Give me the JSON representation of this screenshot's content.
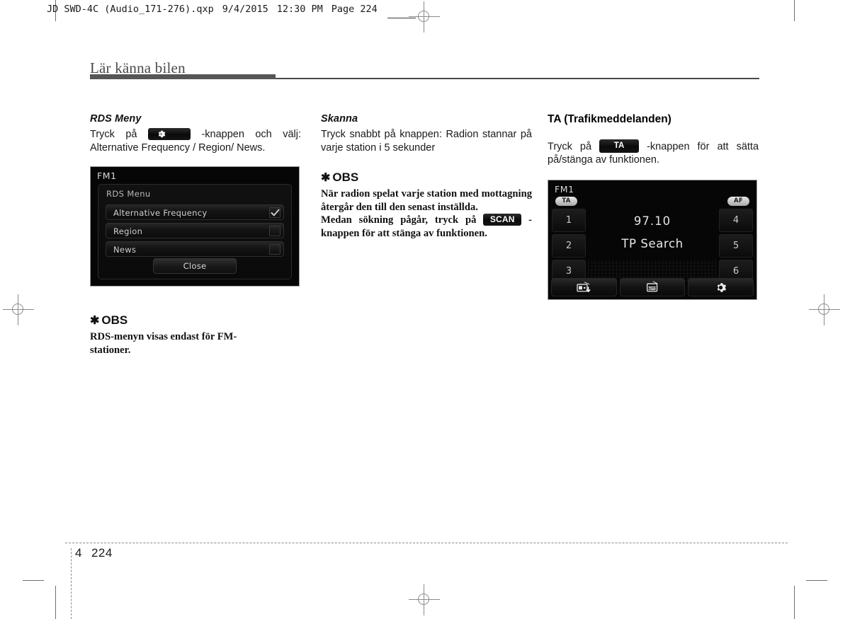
{
  "file_header": {
    "filename": "JD SWD-4C (Audio_171-276).qxp",
    "date": "9/4/2015",
    "time": "12:30 PM",
    "page_label": "Page 224"
  },
  "chapter": {
    "title": "Lär känna bilen"
  },
  "columns": {
    "col1": {
      "rds_heading": "RDS Meny",
      "rds_text_before": "Tryck på",
      "rds_button_icon": "gear-icon",
      "rds_text_after": "-knappen och välj: Alternative Frequency / Region/ News.",
      "device": {
        "label": "FM1",
        "dialog_title": "RDS Menu",
        "items": [
          {
            "label": "Alternative Frequency",
            "checked": true
          },
          {
            "label": "Region",
            "checked": false
          },
          {
            "label": "News",
            "checked": false
          }
        ],
        "close_label": "Close"
      },
      "obs": {
        "star": "✱",
        "heading": "OBS",
        "line1": "RDS-menyn visas endast för FM-",
        "line2": "stationer."
      }
    },
    "col2": {
      "scan_heading": "Skanna",
      "scan_text": "Tryck snabbt på knappen: Radion stannar på varje station i 5 sekunder",
      "obs": {
        "star": "✱",
        "heading": "OBS",
        "para1": "När radion spelat varje station med mottagning återgår den till den senast inställda.",
        "para2_before": "Medan sökning pågår, tryck på",
        "para2_button": "SCAN",
        "para2_after": "-knappen för att stänga av funktionen."
      }
    },
    "col3": {
      "ta_heading": "TA (Trafikmeddelanden)",
      "ta_text_before": "Tryck på",
      "ta_button": "TA",
      "ta_text_after": "-knappen för att sätta på/stänga av funktionen.",
      "device": {
        "label": "FM1",
        "badge_ta": "TA",
        "badge_af": "AF",
        "presets_left": [
          "1",
          "2",
          "3"
        ],
        "presets_right": [
          "4",
          "5",
          "6"
        ],
        "frequency": "97.10",
        "status": "TP Search",
        "bottom_buttons": [
          {
            "icon": "radio-save-preset-icon"
          },
          {
            "icon": "radio-auto-store-icon"
          },
          {
            "icon": "gear-icon"
          }
        ]
      }
    }
  },
  "footer": {
    "chapter_number": "4",
    "page_number": "224"
  },
  "colors": {
    "title_bar": "#565656",
    "device_bg": "#060606",
    "badge": "#d0d0d0"
  }
}
